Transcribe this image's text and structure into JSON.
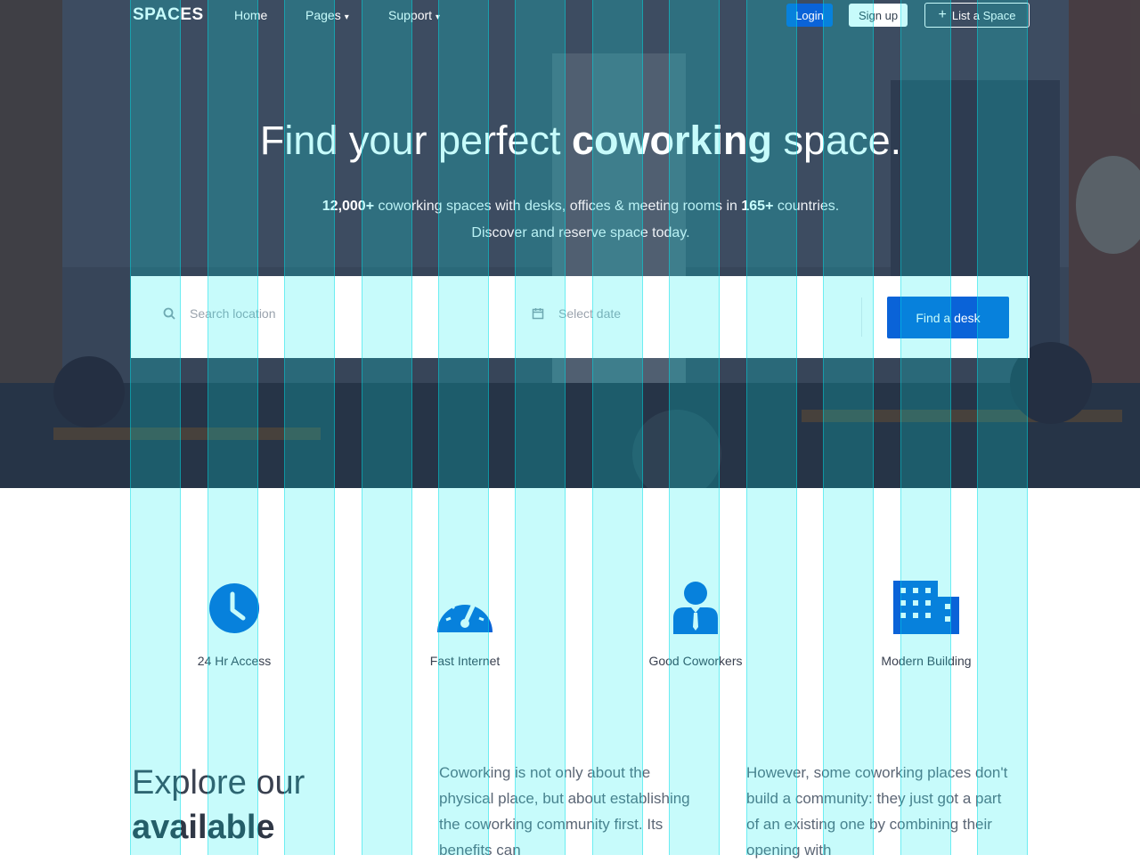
{
  "nav": {
    "brand": "SPACES",
    "links": [
      "Home",
      "Pages",
      "Support"
    ],
    "login": "Login",
    "signup": "Sign up",
    "list_space": "List a Space"
  },
  "hero": {
    "title_pre": "Find your perfect ",
    "title_bold": "coworking",
    "title_post": " space.",
    "sub_bold_1": "12,000+",
    "sub_mid": " coworking spaces with desks, offices & meeting rooms in ",
    "sub_bold_2": "165+",
    "sub_end": " countries.",
    "sub_line2": "Discover and reserve space today."
  },
  "search": {
    "location_placeholder": "Search location",
    "date_placeholder": "Select date",
    "button": "Find a desk"
  },
  "features": [
    {
      "label": "24 Hr Access",
      "icon": "clock-icon"
    },
    {
      "label": "Fast Internet",
      "icon": "speedometer-icon"
    },
    {
      "label": "Good Coworkers",
      "icon": "person-icon"
    },
    {
      "label": "Modern Building",
      "icon": "building-icon"
    }
  ],
  "explore": {
    "heading_line1": "Explore our",
    "heading_line2": "available",
    "para1": "Coworking is not only about the physical place, but about establishing the coworking community first. Its benefits can",
    "para2": "However, some coworking places don't build a community: they just got a part of an existing one by combining their opening with"
  },
  "colors": {
    "accent": "#0a63d8",
    "grid_overlay": "#00eeee"
  }
}
